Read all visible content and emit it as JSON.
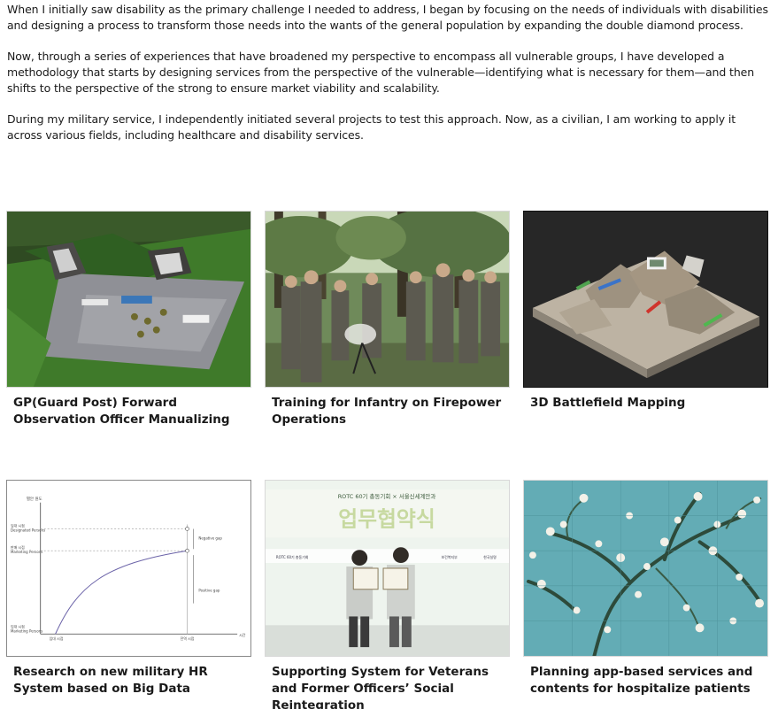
{
  "intro": {
    "paragraphs": [
      "When I initially saw disability as the primary challenge I needed to address, I began by focusing on the needs of individuals with disabilities and designing a process to transform those needs into the wants of the general population by expanding the double diamond process.",
      "Now, through a series of experiences that have broadened my perspective to encompass all vulnerable groups, I have developed a methodology that starts by designing services from the perspective of the vulnerable—identifying what is necessary for them—and then shifts to the perspective of the strong to ensure market viability and scalability.",
      "During my military service, I independently initiated several projects to test this approach. Now, as a civilian, I am working to apply it across various fields, including healthcare and disability services."
    ]
  },
  "projects": [
    {
      "title": "GP(Guard Post) Forward Observation Officer Manualizing"
    },
    {
      "title": "Training for Infantry on Firepower Operations"
    },
    {
      "title": "3D Battlefield Mapping"
    },
    {
      "title": "Research on new military HR System based on Big Data"
    },
    {
      "title": "Supporting System for Veterans and Former Officers’ Social Reintegration"
    },
    {
      "title": "Planning app-based services and contents for hospitalize patients"
    }
  ],
  "hr_chart": {
    "y_title": "별안 원도",
    "y_labels": [
      "일대 시점\nDesignated Persons",
      "판매 시점\nMarketing Persons",
      "입대 시점\nMarketing Persons"
    ],
    "negative_gap": "Negative gap",
    "positive_gap": "Positive gap",
    "x_labels": [
      "입대 시점",
      "전역 시점",
      "시간"
    ]
  },
  "ceremony": {
    "banner_top": "ROTC 60기 총동기회 × 서울신세계안과",
    "banner_main": "업무협약식",
    "logos": [
      "ROTC 60기 총동기회",
      "보건복지부",
      "한국실명"
    ]
  }
}
